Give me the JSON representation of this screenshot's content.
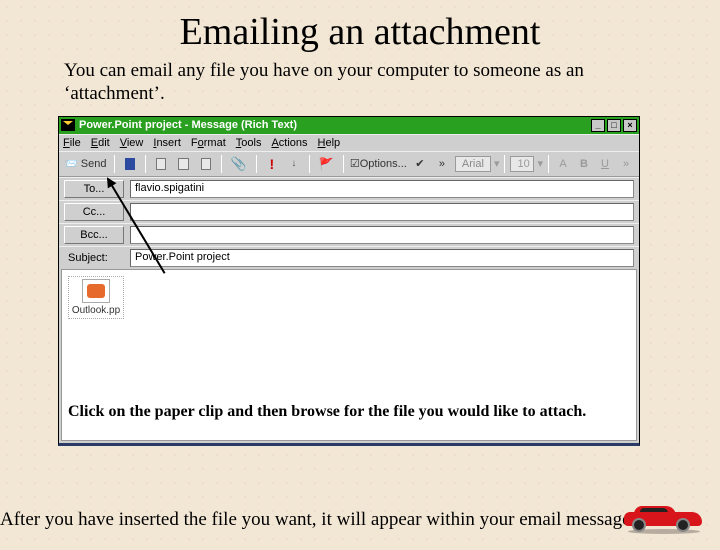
{
  "title": "Emailing an attachment",
  "intro": "You can email any file you have on your computer to someone as an ‘attachment’.",
  "window": {
    "title": "Power.Point project - Message (Rich Text)",
    "menu": {
      "file": "File",
      "edit": "Edit",
      "view": "View",
      "insert": "Insert",
      "format": "Format",
      "tools": "Tools",
      "actions": "Actions",
      "help": "Help"
    },
    "toolbar": {
      "send": "Send",
      "options": "Options...",
      "font_name": "Arial",
      "font_size": "10",
      "format_a": "A",
      "format_b": "B",
      "format_u": "U"
    },
    "fields": {
      "to_label": "To...",
      "to_value": "flavio.spigatini",
      "cc_label": "Cc...",
      "cc_value": "",
      "bcc_label": "Bcc...",
      "bcc_value": "",
      "subject_label": "Subject:",
      "subject_value": "Power.Point project"
    },
    "attachment_name": "Outlook.pp"
  },
  "body_caption": "Click on the paper clip and then browse for the file you would like to attach.",
  "footer": "After you have inserted the file you want, it will appear within your email message."
}
